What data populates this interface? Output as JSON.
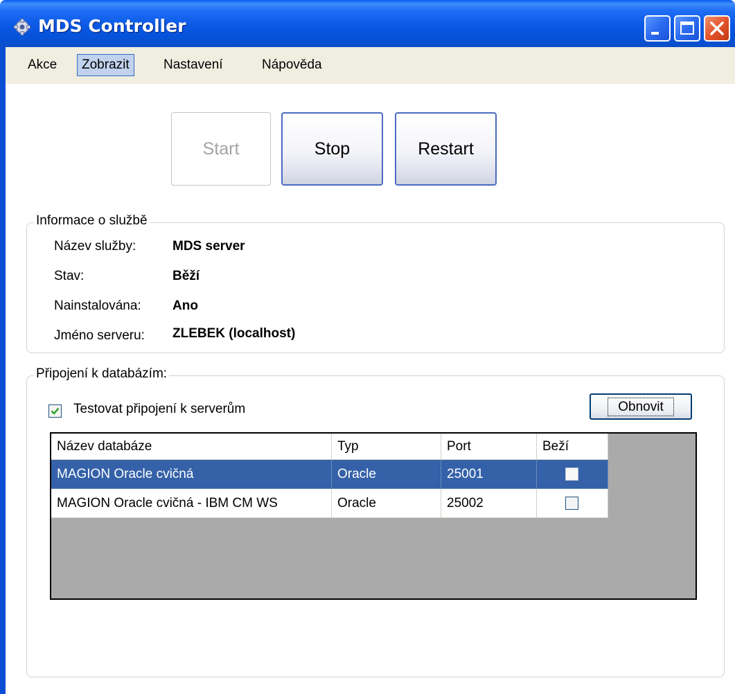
{
  "window": {
    "title": "MDS Controller",
    "accent": "#0a58e4",
    "app_icon": "gear-icon"
  },
  "menu": {
    "items": [
      {
        "label": "Akce"
      },
      {
        "label": "Zobrazit",
        "active": true
      },
      {
        "label": "Nastavení"
      },
      {
        "label": "Nápověda"
      }
    ]
  },
  "controls": {
    "start_label": "Start",
    "start_enabled": false,
    "stop_label": "Stop",
    "restart_label": "Restart"
  },
  "service_info": {
    "legend": "Informace o službě",
    "name_label": "Název služby:",
    "name_value": "MDS server",
    "status_label": "Stav:",
    "status_value": "Běží",
    "installed_label": "Nainstalována:",
    "installed_value": "Ano",
    "server_label": "Jméno serveru:",
    "server_value": "ZLEBEK (localhost)"
  },
  "db": {
    "legend": "Připojení k databázím:",
    "test_label": "Testovat připojení k serverům",
    "test_checked": true,
    "refresh_label": "Obnovit",
    "columns": [
      "Název databáze",
      "Typ",
      "Port",
      "Beží"
    ],
    "rows": [
      {
        "name": "MAGION Oracle cvičná",
        "type": "Oracle",
        "port": "25001",
        "running": false,
        "selected": true
      },
      {
        "name": "MAGION Oracle cvičná - IBM CM WS",
        "type": "Oracle",
        "port": "25002",
        "running": false,
        "selected": false
      }
    ]
  }
}
